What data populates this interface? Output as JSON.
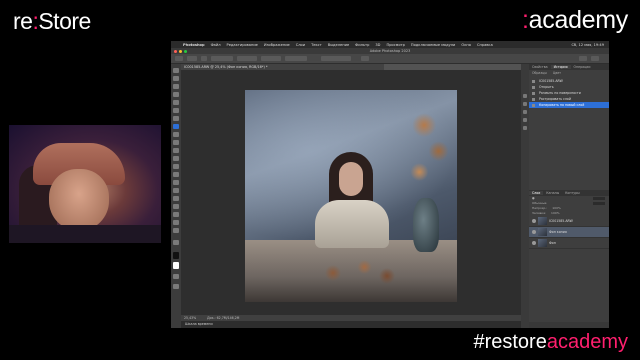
{
  "overlay": {
    "brand_left_a": "re",
    "brand_left_colon": ":",
    "brand_left_b": "Store",
    "brand_right_colon": ":",
    "brand_right_b": "academy",
    "hashtag_a": "#restore",
    "hashtag_b": "academy",
    "accent_color": "#ff1f6e"
  },
  "macos_menu": {
    "app": "Photoshop",
    "items": [
      "Файл",
      "Редактирование",
      "Изображение",
      "Слои",
      "Текст",
      "Выделение",
      "Фильтр",
      "3D",
      "Просмотр",
      "Подключаемые модули",
      "Окно",
      "Справка"
    ],
    "clock": "Сб, 12 мая, 19:49"
  },
  "window": {
    "title": "Adobe Photoshop 2023"
  },
  "document": {
    "tab_title": "IC001585.ARW @ 25,4% (Фон копия, RGB/16*) *",
    "zoom": "25,43%",
    "status": "Док.: 62,7M/146,2M",
    "timeline_label": "Шкала времени"
  },
  "panels": {
    "top_tabs": [
      "Свойства",
      "История",
      "Операции"
    ],
    "top_active": "История",
    "extra_tabs": [
      "Образцы",
      "Цвет"
    ],
    "history_items": [
      "IC001585.ARW",
      "Открыть",
      "Размыть по поверхности",
      "Растрировать слой",
      "Копировать на новый слой"
    ],
    "history_selected": 4,
    "layers_tabs": [
      "Слои",
      "Каналы",
      "Контуры"
    ],
    "layers_active": "Слои",
    "blend_mode": "Обычные",
    "opacity_label": "Непрозр.:",
    "opacity_value": "100%",
    "fill_label": "Заливка:",
    "fill_value": "100%",
    "layers": [
      {
        "name": "IC001585.ARW",
        "thumb": "photo"
      },
      {
        "name": "Фон копия",
        "thumb": "photo"
      },
      {
        "name": "Фон",
        "thumb": "photo"
      }
    ],
    "layer_selected": 1
  }
}
